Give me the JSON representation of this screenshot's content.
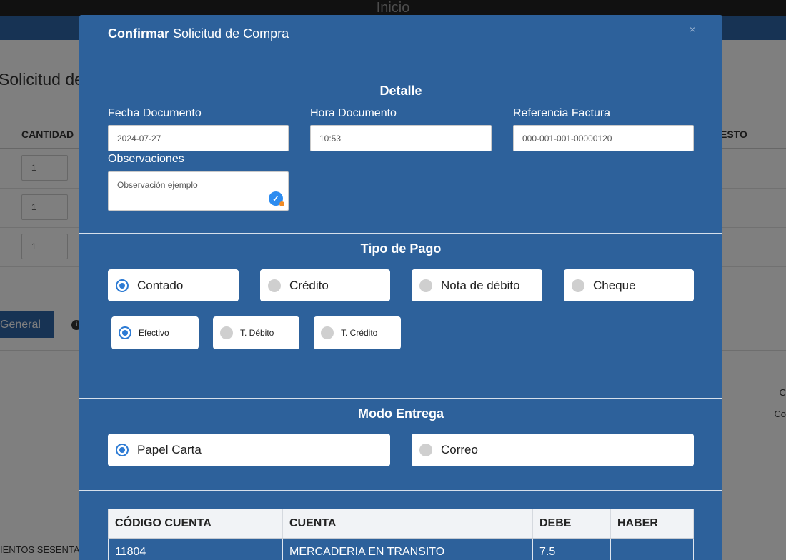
{
  "background": {
    "top_title": "Inicio",
    "heading": "Solicitud de",
    "table_headers": {
      "cantidad": "CANTIDAD",
      "right": "ESTO"
    },
    "qty_values": [
      "1",
      "1",
      "1"
    ],
    "tab_active": "General",
    "tab_info_icon": "info-icon",
    "right_text_1": "C",
    "right_text_2": "Co",
    "footer_text": "IENTOS SESENTA"
  },
  "modal": {
    "title_bold": "Confirmar",
    "title_rest": "Solicitud de Compra",
    "close_symbol": "×",
    "detalle": {
      "title": "Detalle",
      "fecha_label": "Fecha Documento",
      "fecha_value": "2024-07-27",
      "hora_label": "Hora Documento",
      "hora_value": "10:53",
      "referencia_label": "Referencia Factura",
      "referencia_value": "000-001-001-00000120",
      "observaciones_label": "Observaciones",
      "observaciones_value": "Observación ejemplo"
    },
    "tipo_pago": {
      "title": "Tipo de Pago",
      "options": [
        {
          "label": "Contado",
          "checked": true
        },
        {
          "label": "Crédito",
          "checked": false
        },
        {
          "label": "Nota de débito",
          "checked": false
        },
        {
          "label": "Cheque",
          "checked": false
        }
      ],
      "sub_options": [
        {
          "label": "Efectivo",
          "checked": true
        },
        {
          "label": "T. Débito",
          "checked": false
        },
        {
          "label": "T. Crédito",
          "checked": false
        }
      ]
    },
    "modo_entrega": {
      "title": "Modo Entrega",
      "options": [
        {
          "label": "Papel Carta",
          "checked": true
        },
        {
          "label": "Correo",
          "checked": false
        }
      ]
    },
    "cuentas_table": {
      "headers": [
        "CÓDIGO CUENTA",
        "CUENTA",
        "DEBE",
        "HABER"
      ],
      "rows": [
        {
          "codigo": "11804",
          "cuenta": "MERCADERIA EN TRANSITO",
          "debe": "7.5",
          "haber": ""
        }
      ]
    }
  },
  "colors": {
    "modal_bg": "#2d619b",
    "accent_radio": "#2d7bd4",
    "top_bar": "#222222",
    "blue_bar": "#2f66a8"
  }
}
